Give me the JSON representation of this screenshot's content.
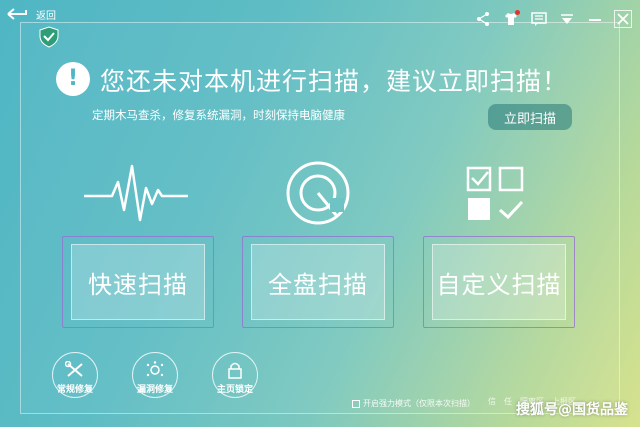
{
  "topbar": {
    "back_label": "返回",
    "icons": [
      "share-icon",
      "tshirt-skin-icon",
      "chat-feedback-icon",
      "menu-dropdown-icon",
      "minimize-icon",
      "close-icon"
    ]
  },
  "main": {
    "headline": "您还未对本机进行扫描，建议立即扫描！",
    "subline": "定期木马查杀，修复系统漏洞，时刻保持电脑健康",
    "scan_now_label": "立即扫描"
  },
  "scan_options": [
    {
      "label": "快速扫描",
      "icon": "heartbeat-icon"
    },
    {
      "label": "全盘扫描",
      "icon": "radar-dial-icon"
    },
    {
      "label": "自定义扫描",
      "icon": "checklist-icon"
    }
  ],
  "tools": [
    {
      "label": "常规修复",
      "icon": "wrench-screwdriver-icon"
    },
    {
      "label": "漏洞修复",
      "icon": "bug-dots-icon"
    },
    {
      "label": "主页锁定",
      "icon": "lock-icon"
    }
  ],
  "footer": {
    "mode_text": "开启强力模式（仅限本次扫描）",
    "links": [
      "信",
      "任",
      "隔离区",
      "上报区"
    ],
    "watermark": "搜狐号@国货品鉴"
  },
  "colors": {
    "accent": "#4fb6c4",
    "button_bg": "#2b7a7a",
    "box_border": "#966ed2"
  }
}
